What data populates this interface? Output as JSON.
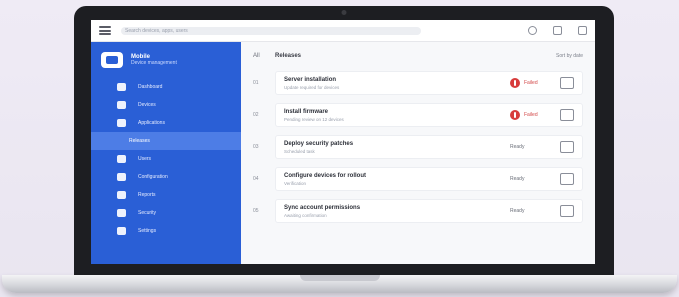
{
  "app": {
    "brand_title": "Mobile",
    "brand_subtitle": "Device management"
  },
  "topbar": {
    "search_placeholder": "Search devices, apps, users"
  },
  "sidebar": {
    "items": [
      {
        "label": "Dashboard",
        "icon": "grid-icon",
        "active": false
      },
      {
        "label": "Devices",
        "icon": "phone-icon",
        "active": false
      },
      {
        "label": "Applications",
        "icon": "apps-icon",
        "active": false
      },
      {
        "label": "Releases",
        "icon": "release-icon",
        "active": true
      },
      {
        "label": "Users",
        "icon": "users-icon",
        "active": false
      },
      {
        "label": "Configuration",
        "icon": "config-icon",
        "active": false
      },
      {
        "label": "Reports",
        "icon": "report-icon",
        "active": false
      },
      {
        "label": "Security",
        "icon": "shield-icon",
        "active": false
      },
      {
        "label": "Settings",
        "icon": "gear-icon",
        "active": false
      }
    ]
  },
  "main": {
    "back_label": "All",
    "title": "Releases",
    "sort_label": "Sort by date",
    "rows": [
      {
        "num": "01",
        "name": "Server installation",
        "sub": "Update required for devices",
        "status": "Failed",
        "alert": true
      },
      {
        "num": "02",
        "name": "Install firmware",
        "sub": "Pending review on 12 devices",
        "status": "Failed",
        "alert": true
      },
      {
        "num": "03",
        "name": "Deploy security patches",
        "sub": "Scheduled task",
        "status": "Ready",
        "alert": false
      },
      {
        "num": "04",
        "name": "Configure devices for rollout",
        "sub": "Verification",
        "status": "Ready",
        "alert": false
      },
      {
        "num": "05",
        "name": "Sync account permissions",
        "sub": "Awaiting confirmation",
        "status": "Ready",
        "alert": false
      }
    ]
  }
}
